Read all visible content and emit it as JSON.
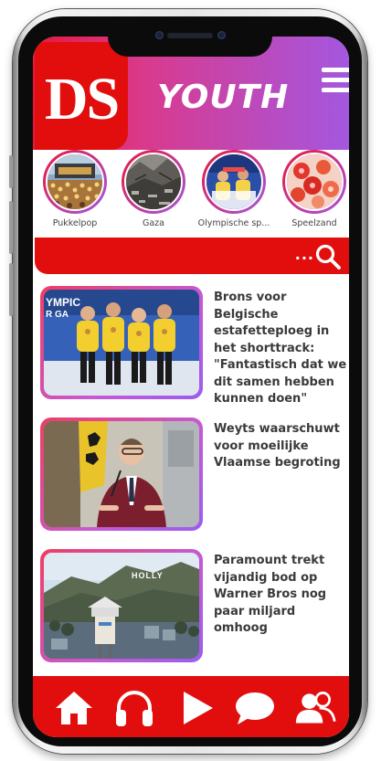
{
  "app": {
    "logo": "DS",
    "title": "YOUTH"
  },
  "header": {
    "menu_icon": "hamburger-menu-icon"
  },
  "stories": [
    {
      "label": "Pukkelpop",
      "image": "festival-crowd-photo"
    },
    {
      "label": "Gaza",
      "image": "rubble-photo"
    },
    {
      "label": "Olympische sp...",
      "image": "olympic-athletes-photo"
    },
    {
      "label": "Speelzand",
      "image": "red-sand-toys-photo"
    }
  ],
  "search": {
    "dots": "...",
    "icon": "search-icon"
  },
  "articles": [
    {
      "headline": "Brons voor Belgische estafetteploeg in het shorttrack: \"Fantastisch dat we dit samen hebben kunnen doen\"",
      "image": "shorttrack-team-podium-photo"
    },
    {
      "headline": "Weyts waarschuwt voor moeilijke Vlaamse begroting",
      "image": "politician-speech-photo"
    },
    {
      "headline": "Paramount trekt vijandig bod op Warner Bros nog paar miljard omhoog",
      "image": "hollywood-sign-photo"
    }
  ],
  "bottom_nav": [
    {
      "name": "home",
      "icon": "home-icon"
    },
    {
      "name": "audio",
      "icon": "headphones-icon"
    },
    {
      "name": "video",
      "icon": "play-icon"
    },
    {
      "name": "chat",
      "icon": "chat-bubble-icon"
    },
    {
      "name": "community",
      "icon": "users-icon"
    }
  ],
  "colors": {
    "brand_red": "#e20e0e",
    "gradient_start": "#e8173e",
    "gradient_end": "#a457e0",
    "headline_text": "#3a3a3a"
  }
}
